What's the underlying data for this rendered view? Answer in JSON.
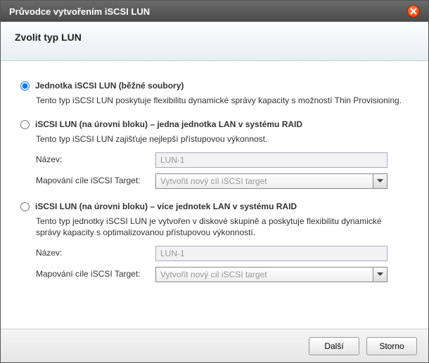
{
  "window": {
    "title": "Průvodce vytvořením iSCSI LUN"
  },
  "header": {
    "title": "Zvolit typ LUN"
  },
  "options": [
    {
      "title": "Jednotka iSCSI LUN (běžné soubory)",
      "desc": "Tento typ iSCSI LUN poskytuje flexibilitu dynamické správy kapacity s možností Thin Provisioning.",
      "selected": true
    },
    {
      "title": "iSCSI LUN (na úrovni bloku) – jedna jednotka LAN v systému RAID",
      "desc": "Tento typ iSCSI LUN zajišťuje nejlepší přístupovou výkonnost.",
      "selected": false,
      "fields": {
        "name_label": "Název:",
        "name_value": "LUN-1",
        "map_label": "Mapování cíle iSCSI Target:",
        "map_value": "Vytvořit nový cíl iSCSI target"
      }
    },
    {
      "title": "iSCSI LUN (na úrovni bloku) – více jednotek LAN v systému RAID",
      "desc": "Tento typ jednotky iSCSI LUN je vytvořen v diskové skupině a poskytuje flexibilitu dynamické správy kapacity s optimalizovanou přístupovou výkonností.",
      "selected": false,
      "fields": {
        "name_label": "Název:",
        "name_value": "LUN-1",
        "map_label": "Mapování cíle iSCSI Target:",
        "map_value": "Vytvořit nový cíl iSCSI target"
      }
    }
  ],
  "footer": {
    "next": "Další",
    "cancel": "Storno"
  }
}
